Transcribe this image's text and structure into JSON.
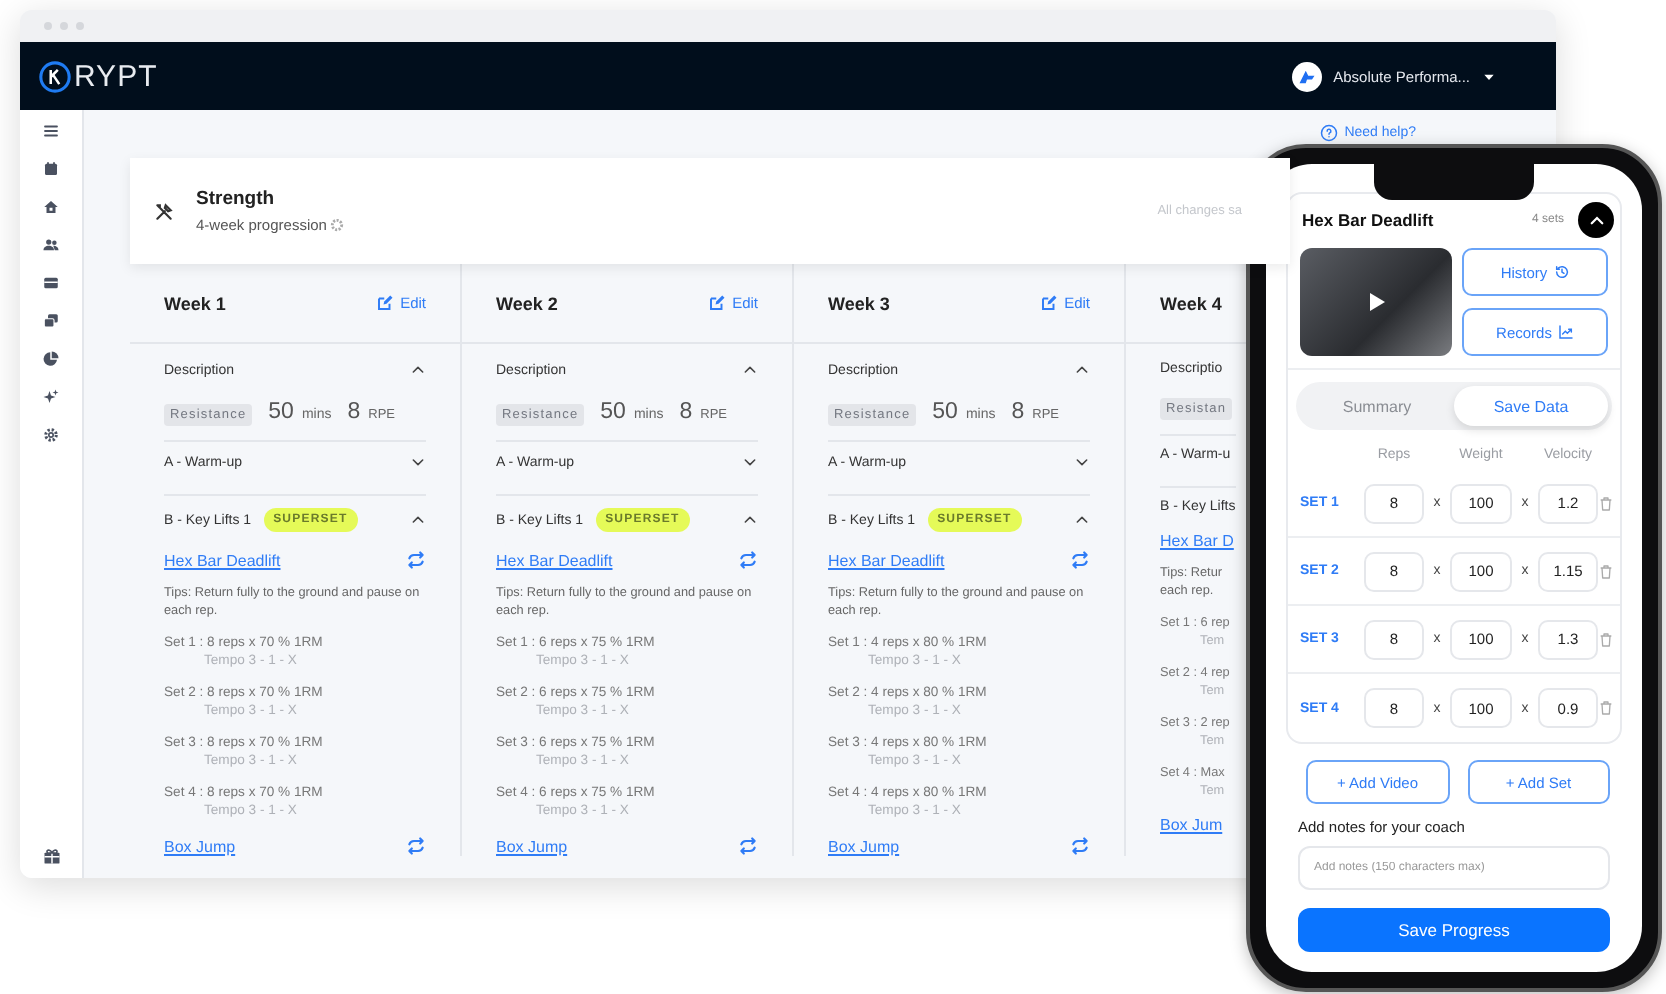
{
  "browser": {
    "logo_text": "RYPT",
    "account_name": "Absolute Performa...",
    "help_link": "Need help?",
    "program": {
      "title": "Strength",
      "subtitle": "4-week progression",
      "save_status": "All changes sa"
    },
    "weeks": [
      {
        "title": "Week 1",
        "edit_label": "Edit",
        "description_label": "Description",
        "description_expanded": true,
        "tag": "Resistance",
        "duration": "50",
        "duration_unit": "mins",
        "rpe": "8",
        "rpe_unit": "RPE",
        "sections": [
          {
            "title": "A - Warm-up",
            "expanded": false
          },
          {
            "title": "B - Key Lifts 1",
            "badge": "SUPERSET",
            "expanded": true
          }
        ],
        "exercise": "Hex Bar Deadlift",
        "tips": [
          "Tips: Return fully to the ground and pause on",
          "each rep."
        ],
        "sets": [
          {
            "text": "Set 1 : 8 reps x 70 % 1RM",
            "tempo": "Tempo 3 - 1 - X"
          },
          {
            "text": "Set 2 : 8 reps x 70 % 1RM",
            "tempo": "Tempo 3 - 1 - X"
          },
          {
            "text": "Set 3 : 8 reps x 70 % 1RM",
            "tempo": "Tempo 3 - 1 - X"
          },
          {
            "text": "Set 4 : 8 reps x 70 % 1RM",
            "tempo": "Tempo 3 - 1 - X"
          }
        ],
        "next_exercise": "Box Jump"
      },
      {
        "title": "Week 2",
        "edit_label": "Edit",
        "description_label": "Description",
        "description_expanded": true,
        "tag": "Resistance",
        "duration": "50",
        "duration_unit": "mins",
        "rpe": "8",
        "rpe_unit": "RPE",
        "sections": [
          {
            "title": "A - Warm-up",
            "expanded": false
          },
          {
            "title": "B - Key Lifts 1",
            "badge": "SUPERSET",
            "expanded": true
          }
        ],
        "exercise": "Hex Bar Deadlift",
        "tips": [
          "Tips: Return fully to the ground and pause on",
          "each rep."
        ],
        "sets": [
          {
            "text": "Set 1 : 6 reps x 75 % 1RM",
            "tempo": "Tempo 3 - 1 - X"
          },
          {
            "text": "Set 2 : 6 reps x 75 % 1RM",
            "tempo": "Tempo 3 - 1 - X"
          },
          {
            "text": "Set 3 : 6 reps x 75 % 1RM",
            "tempo": "Tempo 3 - 1 - X"
          },
          {
            "text": "Set 4 : 6 reps x 75 % 1RM",
            "tempo": "Tempo 3 - 1 - X"
          }
        ],
        "next_exercise": "Box Jump"
      },
      {
        "title": "Week 3",
        "edit_label": "Edit",
        "description_label": "Description",
        "description_expanded": true,
        "tag": "Resistance",
        "duration": "50",
        "duration_unit": "mins",
        "rpe": "8",
        "rpe_unit": "RPE",
        "sections": [
          {
            "title": "A - Warm-up",
            "expanded": false
          },
          {
            "title": "B - Key Lifts 1",
            "badge": "SUPERSET",
            "expanded": true
          }
        ],
        "exercise": "Hex Bar Deadlift",
        "tips": [
          "Tips: Return fully to the ground and pause on",
          "each rep."
        ],
        "sets": [
          {
            "text": "Set 1 : 4 reps x 80 % 1RM",
            "tempo": "Tempo 3 - 1 - X"
          },
          {
            "text": "Set 2 : 4 reps x 80 % 1RM",
            "tempo": "Tempo 3 - 1 - X"
          },
          {
            "text": "Set 3 : 4 reps x 80 % 1RM",
            "tempo": "Tempo 3 - 1 - X"
          },
          {
            "text": "Set 4 : 4 reps x 80 % 1RM",
            "tempo": "Tempo 3 - 1 - X"
          }
        ],
        "next_exercise": "Box Jump"
      },
      {
        "title": "Week 4",
        "description_label": "Descriptio",
        "tag": "Resistan",
        "sections": [
          {
            "title": "A - Warm-u"
          },
          {
            "title": "B - Key Lifts"
          }
        ],
        "exercise": "Hex Bar D",
        "tips": [
          "Tips: Retur",
          "each rep."
        ],
        "sets": [
          {
            "text": "Set 1 : 6 rep",
            "tempo": "Tem"
          },
          {
            "text": "Set 2 : 4 rep",
            "tempo": "Tem"
          },
          {
            "text": "Set 3 : 2 rep",
            "tempo": "Tem"
          },
          {
            "text": "Set 4 : Max",
            "tempo": "Tem"
          }
        ],
        "next_exercise": "Box Jum"
      }
    ]
  },
  "phone": {
    "exercise": "Hex Bar Deadlift",
    "set_count": "4 sets",
    "expanded": true,
    "history_button": "History",
    "records_button": "Records",
    "view_tabs": [
      {
        "label": "Summary",
        "selected": false
      },
      {
        "label": "Save Data",
        "selected": true
      }
    ],
    "columns": [
      "Reps",
      "Weight",
      "Velocity"
    ],
    "sets": [
      {
        "label": "SET 1",
        "reps": "8",
        "weight": "100",
        "velocity": "1.2",
        "separators": [
          "x",
          "x"
        ]
      },
      {
        "label": "SET 2",
        "reps": "8",
        "weight": "100",
        "velocity": "1.15",
        "separators": [
          "x",
          "x"
        ]
      },
      {
        "label": "SET 3",
        "reps": "8",
        "weight": "100",
        "velocity": "1.3",
        "separators": [
          "x",
          "x"
        ]
      },
      {
        "label": "SET 4",
        "reps": "8",
        "weight": "100",
        "velocity": "0.9",
        "separators": [
          "x",
          "x"
        ]
      }
    ],
    "add_video_button": "+ Add Video",
    "add_set_button": "+ Add Set",
    "notes_label": "Add notes for your coach",
    "notes_placeholder": "Add notes (150 characters max)",
    "save_button": "Save Progress"
  }
}
